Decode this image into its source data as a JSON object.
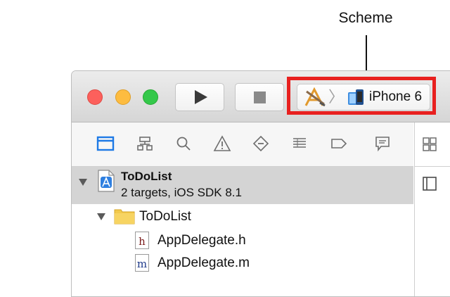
{
  "callout": {
    "label": "Scheme"
  },
  "toolbar": {
    "run_icon": "play-icon",
    "stop_icon": "stop-icon",
    "scheme": {
      "app_icon": "xcode-app-icon",
      "separator": "〉",
      "device_icon": "simulator-icon",
      "device": "iPhone 6"
    }
  },
  "navigator": {
    "icons": [
      "folder-icon",
      "symbol-hierarchy-icon",
      "search-icon",
      "warning-icon",
      "test-diamond-icon",
      "debug-list-icon",
      "breakpoint-tag-icon",
      "report-bubble-icon"
    ],
    "selected": "folder-icon"
  },
  "project": {
    "name": "ToDoList",
    "subtitle": "2 targets, iOS SDK 8.1"
  },
  "tree": {
    "group": {
      "name": "ToDoList"
    },
    "files": [
      {
        "name": "AppDelegate.h",
        "badge": "h"
      },
      {
        "name": "AppDelegate.m",
        "badge": "m"
      }
    ]
  },
  "colors": {
    "highlight": "#e8201f",
    "accent": "#1e7ae6",
    "selection": "#d4d4d4"
  }
}
